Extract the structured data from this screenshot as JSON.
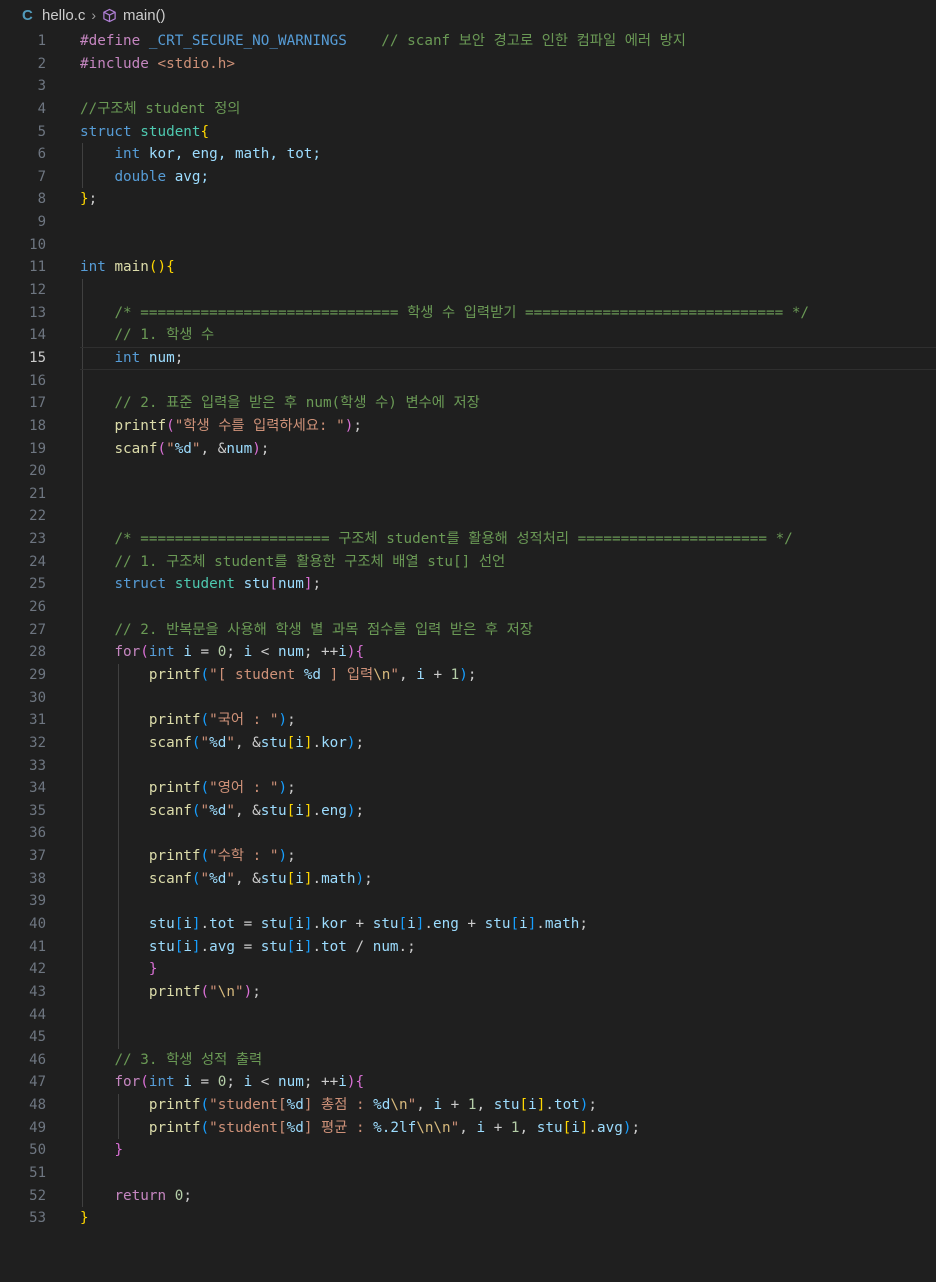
{
  "breadcrumb": {
    "file": "hello.c",
    "symbol": "main()"
  },
  "editor": {
    "current_line": 15,
    "lines": [
      [
        {
          "t": "#define ",
          "c": "pp"
        },
        {
          "t": "_CRT_SECURE_NO_WARNINGS",
          "c": "k"
        },
        {
          "t": "    ",
          "c": ""
        },
        {
          "t": "// scanf 보안 경고로 인한 컴파일 에러 방지",
          "c": "m"
        }
      ],
      [
        {
          "t": "#include ",
          "c": "pp"
        },
        {
          "t": "<stdio.h>",
          "c": "s"
        }
      ],
      [],
      [
        {
          "t": "//구조체 student 정의",
          "c": "m"
        }
      ],
      [
        {
          "t": "struct ",
          "c": "k"
        },
        {
          "t": "student",
          "c": "t"
        },
        {
          "t": "{",
          "c": "b1"
        }
      ],
      [
        {
          "t": "    ",
          "c": ""
        },
        {
          "t": "int ",
          "c": "k"
        },
        {
          "t": "kor, eng, math, tot;",
          "c": "v"
        }
      ],
      [
        {
          "t": "    ",
          "c": ""
        },
        {
          "t": "double ",
          "c": "k"
        },
        {
          "t": "avg;",
          "c": "v"
        }
      ],
      [
        {
          "t": "}",
          "c": "b1"
        },
        {
          "t": ";",
          "c": ""
        }
      ],
      [],
      [],
      [
        {
          "t": "int ",
          "c": "k"
        },
        {
          "t": "main",
          "c": "f"
        },
        {
          "t": "()",
          "c": "b1"
        },
        {
          "t": "{",
          "c": "b1"
        }
      ],
      [],
      [
        {
          "t": "    ",
          "c": ""
        },
        {
          "t": "/* ============================== 학생 수 입력받기 ============================== */",
          "c": "m"
        }
      ],
      [
        {
          "t": "    ",
          "c": ""
        },
        {
          "t": "// 1. 학생 수",
          "c": "m"
        }
      ],
      [
        {
          "t": "    ",
          "c": ""
        },
        {
          "t": "int ",
          "c": "k"
        },
        {
          "t": "num",
          "c": "v"
        },
        {
          "t": ";",
          "c": ""
        }
      ],
      [],
      [
        {
          "t": "    ",
          "c": ""
        },
        {
          "t": "// 2. 표준 입력을 받은 후 num(학생 수) 변수에 저장",
          "c": "m"
        }
      ],
      [
        {
          "t": "    ",
          "c": ""
        },
        {
          "t": "printf",
          "c": "f"
        },
        {
          "t": "(",
          "c": "b2"
        },
        {
          "t": "\"학생 수를 입력하세요: \"",
          "c": "s"
        },
        {
          "t": ")",
          "c": "b2"
        },
        {
          "t": ";",
          "c": ""
        }
      ],
      [
        {
          "t": "    ",
          "c": ""
        },
        {
          "t": "scanf",
          "c": "f"
        },
        {
          "t": "(",
          "c": "b2"
        },
        {
          "t": "\"",
          "c": "s"
        },
        {
          "t": "%d",
          "c": "v"
        },
        {
          "t": "\"",
          "c": "s"
        },
        {
          "t": ", &",
          "c": ""
        },
        {
          "t": "num",
          "c": "v"
        },
        {
          "t": ")",
          "c": "b2"
        },
        {
          "t": ";",
          "c": ""
        }
      ],
      [],
      [],
      [],
      [
        {
          "t": "    ",
          "c": ""
        },
        {
          "t": "/* ====================== 구조체 student를 활용해 성적처리 ====================== */",
          "c": "m"
        }
      ],
      [
        {
          "t": "    ",
          "c": ""
        },
        {
          "t": "// 1. 구조체 student를 활용한 구조체 배열 stu[] 선언",
          "c": "m"
        }
      ],
      [
        {
          "t": "    ",
          "c": ""
        },
        {
          "t": "struct ",
          "c": "k"
        },
        {
          "t": "student ",
          "c": "t"
        },
        {
          "t": "stu",
          "c": "v"
        },
        {
          "t": "[",
          "c": "b2"
        },
        {
          "t": "num",
          "c": "v"
        },
        {
          "t": "]",
          "c": "b2"
        },
        {
          "t": ";",
          "c": ""
        }
      ],
      [],
      [
        {
          "t": "    ",
          "c": ""
        },
        {
          "t": "// 2. 반복문을 사용해 학생 별 과목 점수를 입력 받은 후 저장",
          "c": "m"
        }
      ],
      [
        {
          "t": "    ",
          "c": ""
        },
        {
          "t": "for",
          "c": "c"
        },
        {
          "t": "(",
          "c": "b2"
        },
        {
          "t": "int ",
          "c": "k"
        },
        {
          "t": "i",
          "c": "v"
        },
        {
          "t": " = ",
          "c": ""
        },
        {
          "t": "0",
          "c": "n"
        },
        {
          "t": "; ",
          "c": ""
        },
        {
          "t": "i",
          "c": "v"
        },
        {
          "t": " < ",
          "c": ""
        },
        {
          "t": "num",
          "c": "v"
        },
        {
          "t": "; ++",
          "c": ""
        },
        {
          "t": "i",
          "c": "v"
        },
        {
          "t": ")",
          "c": "b2"
        },
        {
          "t": "{",
          "c": "b2"
        }
      ],
      [
        {
          "t": "        ",
          "c": ""
        },
        {
          "t": "printf",
          "c": "f"
        },
        {
          "t": "(",
          "c": "b3"
        },
        {
          "t": "\"[ student ",
          "c": "s"
        },
        {
          "t": "%d",
          "c": "v"
        },
        {
          "t": " ] 입력",
          "c": "s"
        },
        {
          "t": "\\n",
          "c": "e"
        },
        {
          "t": "\"",
          "c": "s"
        },
        {
          "t": ", ",
          "c": ""
        },
        {
          "t": "i",
          "c": "v"
        },
        {
          "t": " + ",
          "c": ""
        },
        {
          "t": "1",
          "c": "n"
        },
        {
          "t": ")",
          "c": "b3"
        },
        {
          "t": ";",
          "c": ""
        }
      ],
      [],
      [
        {
          "t": "        ",
          "c": ""
        },
        {
          "t": "printf",
          "c": "f"
        },
        {
          "t": "(",
          "c": "b3"
        },
        {
          "t": "\"국어 : \"",
          "c": "s"
        },
        {
          "t": ")",
          "c": "b3"
        },
        {
          "t": ";",
          "c": ""
        }
      ],
      [
        {
          "t": "        ",
          "c": ""
        },
        {
          "t": "scanf",
          "c": "f"
        },
        {
          "t": "(",
          "c": "b3"
        },
        {
          "t": "\"",
          "c": "s"
        },
        {
          "t": "%d",
          "c": "v"
        },
        {
          "t": "\"",
          "c": "s"
        },
        {
          "t": ", &",
          "c": ""
        },
        {
          "t": "stu",
          "c": "v"
        },
        {
          "t": "[",
          "c": "b1"
        },
        {
          "t": "i",
          "c": "v"
        },
        {
          "t": "]",
          "c": "b1"
        },
        {
          "t": ".",
          "c": ""
        },
        {
          "t": "kor",
          "c": "v"
        },
        {
          "t": ")",
          "c": "b3"
        },
        {
          "t": ";",
          "c": ""
        }
      ],
      [],
      [
        {
          "t": "        ",
          "c": ""
        },
        {
          "t": "printf",
          "c": "f"
        },
        {
          "t": "(",
          "c": "b3"
        },
        {
          "t": "\"영어 : \"",
          "c": "s"
        },
        {
          "t": ")",
          "c": "b3"
        },
        {
          "t": ";",
          "c": ""
        }
      ],
      [
        {
          "t": "        ",
          "c": ""
        },
        {
          "t": "scanf",
          "c": "f"
        },
        {
          "t": "(",
          "c": "b3"
        },
        {
          "t": "\"",
          "c": "s"
        },
        {
          "t": "%d",
          "c": "v"
        },
        {
          "t": "\"",
          "c": "s"
        },
        {
          "t": ", &",
          "c": ""
        },
        {
          "t": "stu",
          "c": "v"
        },
        {
          "t": "[",
          "c": "b1"
        },
        {
          "t": "i",
          "c": "v"
        },
        {
          "t": "]",
          "c": "b1"
        },
        {
          "t": ".",
          "c": ""
        },
        {
          "t": "eng",
          "c": "v"
        },
        {
          "t": ")",
          "c": "b3"
        },
        {
          "t": ";",
          "c": ""
        }
      ],
      [],
      [
        {
          "t": "        ",
          "c": ""
        },
        {
          "t": "printf",
          "c": "f"
        },
        {
          "t": "(",
          "c": "b3"
        },
        {
          "t": "\"수학 : \"",
          "c": "s"
        },
        {
          "t": ")",
          "c": "b3"
        },
        {
          "t": ";",
          "c": ""
        }
      ],
      [
        {
          "t": "        ",
          "c": ""
        },
        {
          "t": "scanf",
          "c": "f"
        },
        {
          "t": "(",
          "c": "b3"
        },
        {
          "t": "\"",
          "c": "s"
        },
        {
          "t": "%d",
          "c": "v"
        },
        {
          "t": "\"",
          "c": "s"
        },
        {
          "t": ", &",
          "c": ""
        },
        {
          "t": "stu",
          "c": "v"
        },
        {
          "t": "[",
          "c": "b1"
        },
        {
          "t": "i",
          "c": "v"
        },
        {
          "t": "]",
          "c": "b1"
        },
        {
          "t": ".",
          "c": ""
        },
        {
          "t": "math",
          "c": "v"
        },
        {
          "t": ")",
          "c": "b3"
        },
        {
          "t": ";",
          "c": ""
        }
      ],
      [],
      [
        {
          "t": "        ",
          "c": ""
        },
        {
          "t": "stu",
          "c": "v"
        },
        {
          "t": "[",
          "c": "b3"
        },
        {
          "t": "i",
          "c": "v"
        },
        {
          "t": "]",
          "c": "b3"
        },
        {
          "t": ".",
          "c": ""
        },
        {
          "t": "tot",
          "c": "v"
        },
        {
          "t": " = ",
          "c": ""
        },
        {
          "t": "stu",
          "c": "v"
        },
        {
          "t": "[",
          "c": "b3"
        },
        {
          "t": "i",
          "c": "v"
        },
        {
          "t": "]",
          "c": "b3"
        },
        {
          "t": ".",
          "c": ""
        },
        {
          "t": "kor",
          "c": "v"
        },
        {
          "t": " + ",
          "c": ""
        },
        {
          "t": "stu",
          "c": "v"
        },
        {
          "t": "[",
          "c": "b3"
        },
        {
          "t": "i",
          "c": "v"
        },
        {
          "t": "]",
          "c": "b3"
        },
        {
          "t": ".",
          "c": ""
        },
        {
          "t": "eng",
          "c": "v"
        },
        {
          "t": " + ",
          "c": ""
        },
        {
          "t": "stu",
          "c": "v"
        },
        {
          "t": "[",
          "c": "b3"
        },
        {
          "t": "i",
          "c": "v"
        },
        {
          "t": "]",
          "c": "b3"
        },
        {
          "t": ".",
          "c": ""
        },
        {
          "t": "math",
          "c": "v"
        },
        {
          "t": ";",
          "c": ""
        }
      ],
      [
        {
          "t": "        ",
          "c": ""
        },
        {
          "t": "stu",
          "c": "v"
        },
        {
          "t": "[",
          "c": "b3"
        },
        {
          "t": "i",
          "c": "v"
        },
        {
          "t": "]",
          "c": "b3"
        },
        {
          "t": ".",
          "c": ""
        },
        {
          "t": "avg",
          "c": "v"
        },
        {
          "t": " = ",
          "c": ""
        },
        {
          "t": "stu",
          "c": "v"
        },
        {
          "t": "[",
          "c": "b3"
        },
        {
          "t": "i",
          "c": "v"
        },
        {
          "t": "]",
          "c": "b3"
        },
        {
          "t": ".",
          "c": ""
        },
        {
          "t": "tot",
          "c": "v"
        },
        {
          "t": " / ",
          "c": ""
        },
        {
          "t": "num",
          "c": "v"
        },
        {
          "t": ".;",
          "c": ""
        }
      ],
      [
        {
          "t": "        ",
          "c": ""
        },
        {
          "t": "}",
          "c": "b2"
        }
      ],
      [
        {
          "t": "        ",
          "c": ""
        },
        {
          "t": "printf",
          "c": "f"
        },
        {
          "t": "(",
          "c": "b2"
        },
        {
          "t": "\"",
          "c": "s"
        },
        {
          "t": "\\n",
          "c": "e"
        },
        {
          "t": "\"",
          "c": "s"
        },
        {
          "t": ")",
          "c": "b2"
        },
        {
          "t": ";",
          "c": ""
        }
      ],
      [],
      [],
      [
        {
          "t": "    ",
          "c": ""
        },
        {
          "t": "// 3. 학생 성적 출력",
          "c": "m"
        }
      ],
      [
        {
          "t": "    ",
          "c": ""
        },
        {
          "t": "for",
          "c": "c"
        },
        {
          "t": "(",
          "c": "b2"
        },
        {
          "t": "int ",
          "c": "k"
        },
        {
          "t": "i",
          "c": "v"
        },
        {
          "t": " = ",
          "c": ""
        },
        {
          "t": "0",
          "c": "n"
        },
        {
          "t": "; ",
          "c": ""
        },
        {
          "t": "i",
          "c": "v"
        },
        {
          "t": " < ",
          "c": ""
        },
        {
          "t": "num",
          "c": "v"
        },
        {
          "t": "; ++",
          "c": ""
        },
        {
          "t": "i",
          "c": "v"
        },
        {
          "t": ")",
          "c": "b2"
        },
        {
          "t": "{",
          "c": "b2"
        }
      ],
      [
        {
          "t": "        ",
          "c": ""
        },
        {
          "t": "printf",
          "c": "f"
        },
        {
          "t": "(",
          "c": "b3"
        },
        {
          "t": "\"student[",
          "c": "s"
        },
        {
          "t": "%d",
          "c": "v"
        },
        {
          "t": "] 총점 : ",
          "c": "s"
        },
        {
          "t": "%d",
          "c": "v"
        },
        {
          "t": "\\n",
          "c": "e"
        },
        {
          "t": "\"",
          "c": "s"
        },
        {
          "t": ", ",
          "c": ""
        },
        {
          "t": "i",
          "c": "v"
        },
        {
          "t": " + ",
          "c": ""
        },
        {
          "t": "1",
          "c": "n"
        },
        {
          "t": ", ",
          "c": ""
        },
        {
          "t": "stu",
          "c": "v"
        },
        {
          "t": "[",
          "c": "b1"
        },
        {
          "t": "i",
          "c": "v"
        },
        {
          "t": "]",
          "c": "b1"
        },
        {
          "t": ".",
          "c": ""
        },
        {
          "t": "tot",
          "c": "v"
        },
        {
          "t": ")",
          "c": "b3"
        },
        {
          "t": ";",
          "c": ""
        }
      ],
      [
        {
          "t": "        ",
          "c": ""
        },
        {
          "t": "printf",
          "c": "f"
        },
        {
          "t": "(",
          "c": "b3"
        },
        {
          "t": "\"student[",
          "c": "s"
        },
        {
          "t": "%d",
          "c": "v"
        },
        {
          "t": "] 평균 : ",
          "c": "s"
        },
        {
          "t": "%.2lf",
          "c": "v"
        },
        {
          "t": "\\n\\n",
          "c": "e"
        },
        {
          "t": "\"",
          "c": "s"
        },
        {
          "t": ", ",
          "c": ""
        },
        {
          "t": "i",
          "c": "v"
        },
        {
          "t": " + ",
          "c": ""
        },
        {
          "t": "1",
          "c": "n"
        },
        {
          "t": ", ",
          "c": ""
        },
        {
          "t": "stu",
          "c": "v"
        },
        {
          "t": "[",
          "c": "b1"
        },
        {
          "t": "i",
          "c": "v"
        },
        {
          "t": "]",
          "c": "b1"
        },
        {
          "t": ".",
          "c": ""
        },
        {
          "t": "avg",
          "c": "v"
        },
        {
          "t": ")",
          "c": "b3"
        },
        {
          "t": ";",
          "c": ""
        }
      ],
      [
        {
          "t": "    ",
          "c": ""
        },
        {
          "t": "}",
          "c": "b2"
        }
      ],
      [],
      [
        {
          "t": "    ",
          "c": ""
        },
        {
          "t": "return ",
          "c": "c"
        },
        {
          "t": "0",
          "c": "n"
        },
        {
          "t": ";",
          "c": ""
        }
      ],
      [
        {
          "t": "}",
          "c": "b1"
        }
      ]
    ]
  }
}
